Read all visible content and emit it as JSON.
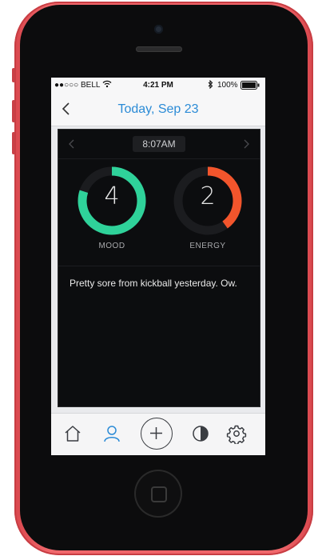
{
  "status_bar": {
    "carrier": "●●○○○ BELL",
    "time": "4:21 PM",
    "battery": "100%",
    "icons": [
      "wifi-icon",
      "bluetooth-icon",
      "battery-icon"
    ]
  },
  "nav": {
    "title": "Today, Sep 23",
    "back_icon": "chevron-left-icon"
  },
  "entry": {
    "time": "8:07AM",
    "mood": {
      "value": "4",
      "label": "MOOD",
      "fraction": 0.8,
      "color": "#2fd29a"
    },
    "energy": {
      "value": "2",
      "label": "ENERGY",
      "fraction": 0.4,
      "color": "#f2552c"
    },
    "note": "Pretty sore from kickball yesterday. Ow."
  },
  "tabs": [
    {
      "name": "home-icon",
      "active": false
    },
    {
      "name": "person-icon",
      "active": true
    },
    {
      "name": "plus-icon",
      "active": false
    },
    {
      "name": "pie-chart-icon",
      "active": false
    },
    {
      "name": "gear-icon",
      "active": false
    }
  ],
  "colors": {
    "accent": "#2b8bd6",
    "phone_body": "#ee6367",
    "card_bg": "#0c0d0f"
  }
}
